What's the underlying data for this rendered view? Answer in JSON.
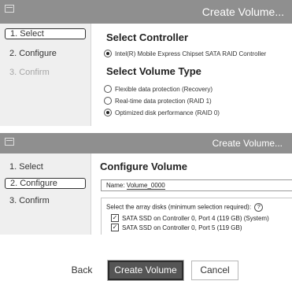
{
  "panel1": {
    "window_title": "Create Volume...",
    "steps": [
      "1. Select",
      "2. Configure",
      "3. Confirm"
    ],
    "heading_controller": "Select Controller",
    "controller_option": "Intel(R) Mobile Express Chipset SATA RAID Controller",
    "heading_volume_type": "Select Volume Type",
    "volume_types": [
      {
        "label": "Flexible data protection (Recovery)",
        "checked": false
      },
      {
        "label": "Real-time data protection (RAID 1)",
        "checked": false
      },
      {
        "label": "Optimized disk performance (RAID 0)",
        "checked": true
      }
    ]
  },
  "panel2": {
    "window_title": "Create Volume...",
    "steps": [
      "1. Select",
      "2. Configure",
      "3. Confirm"
    ],
    "heading": "Configure Volume",
    "name_label": "Name:",
    "name_value": "Volume_0000",
    "disks_label": "Select the array disks (minimum selection required):",
    "help_glyph": "?",
    "disks": [
      {
        "label": "SATA SSD on Controller 0, Port 4 (119 GB) (System)",
        "checked": true
      },
      {
        "label": "SATA SSD on Controller 0, Port 5 (119 GB)",
        "checked": true
      }
    ]
  },
  "buttons": {
    "back": "Back",
    "create": "Create Volume",
    "cancel": "Cancel"
  },
  "icons": {
    "app": "app-window-icon",
    "help": "help-icon",
    "check": "checkmark-icon"
  }
}
